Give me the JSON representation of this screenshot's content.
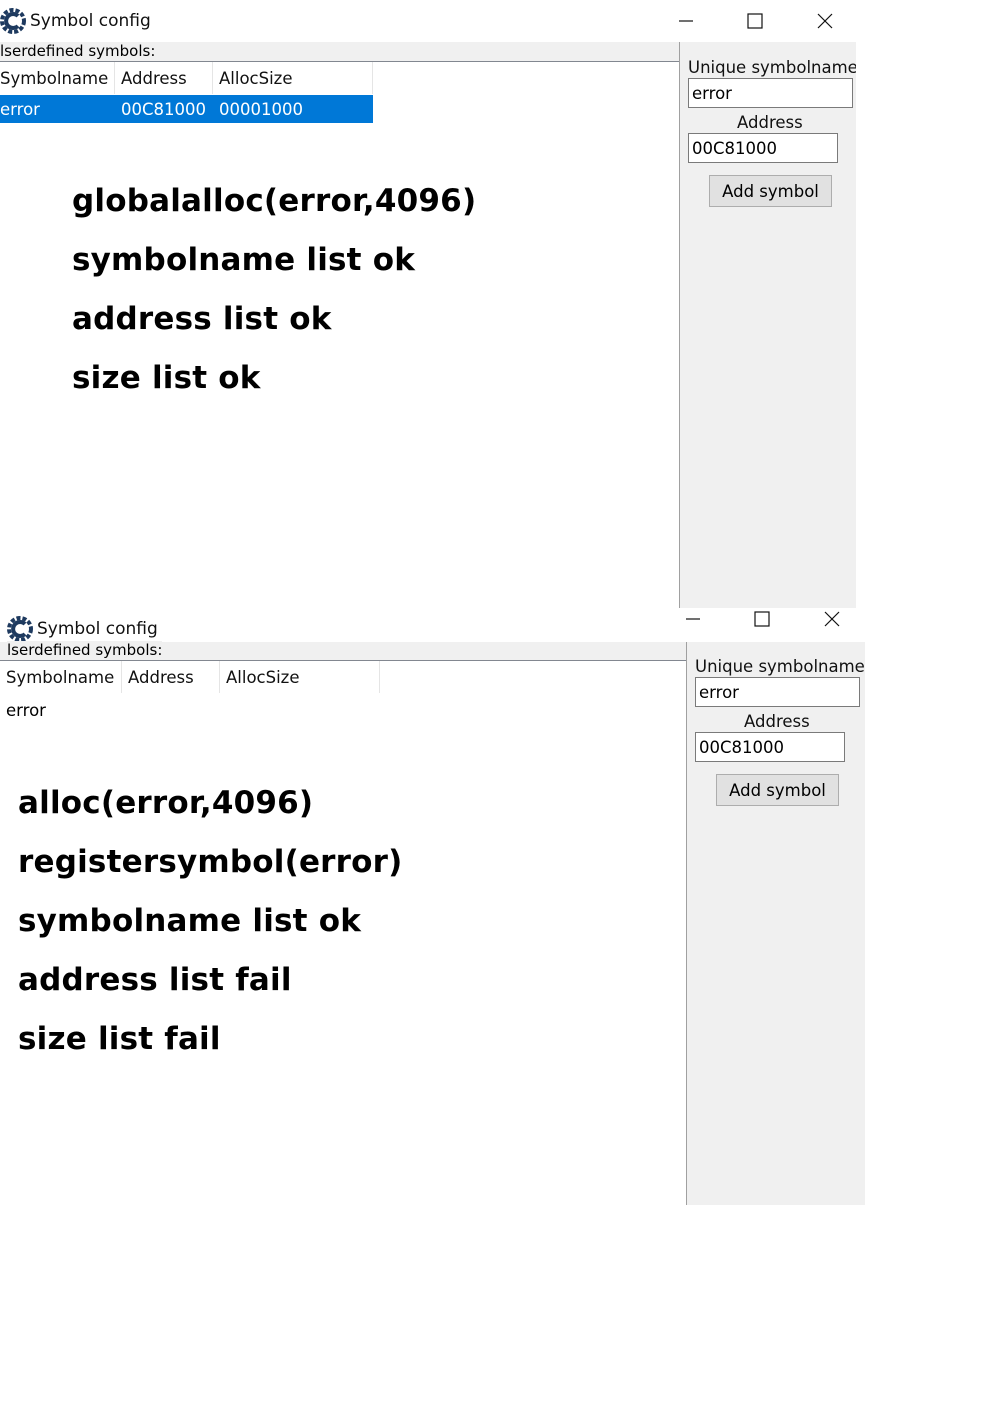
{
  "windows": [
    {
      "title": "Symbol config",
      "section_label": "lserdefined symbols:",
      "columns": [
        "Symbolname",
        "Address",
        "AllocSize"
      ],
      "rows": [
        {
          "symbolname": "error",
          "address": "00C81000",
          "allocsize": "00001000",
          "selected": true
        }
      ],
      "notes": [
        "globalalloc(error,4096)",
        "symbolname list ok",
        "address list ok",
        "size list ok"
      ],
      "panel": {
        "unique_label": "Unique symbolname",
        "unique_value": "error",
        "address_label": "Address",
        "address_value": "00C81000",
        "add_button": "Add symbol"
      }
    },
    {
      "title": "Symbol config",
      "section_label": "lserdefined symbols:",
      "columns": [
        "Symbolname",
        "Address",
        "AllocSize"
      ],
      "rows": [
        {
          "symbolname": "error",
          "address": "",
          "allocsize": "",
          "selected": false
        }
      ],
      "notes": [
        "alloc(error,4096)",
        "registersymbol(error)",
        "symbolname list ok",
        "address list fail",
        "size list fail"
      ],
      "panel": {
        "unique_label": "Unique symbolname",
        "unique_value": "error",
        "address_label": "Address",
        "address_value": "00C81000",
        "add_button": "Add symbol"
      }
    }
  ],
  "icons": {
    "app": "cheat-engine-icon",
    "minimize": "minimize-icon",
    "maximize": "maximize-icon",
    "close": "close-icon"
  },
  "colors": {
    "selection": "#0078d7",
    "panel_bg": "#f0f0f0"
  }
}
